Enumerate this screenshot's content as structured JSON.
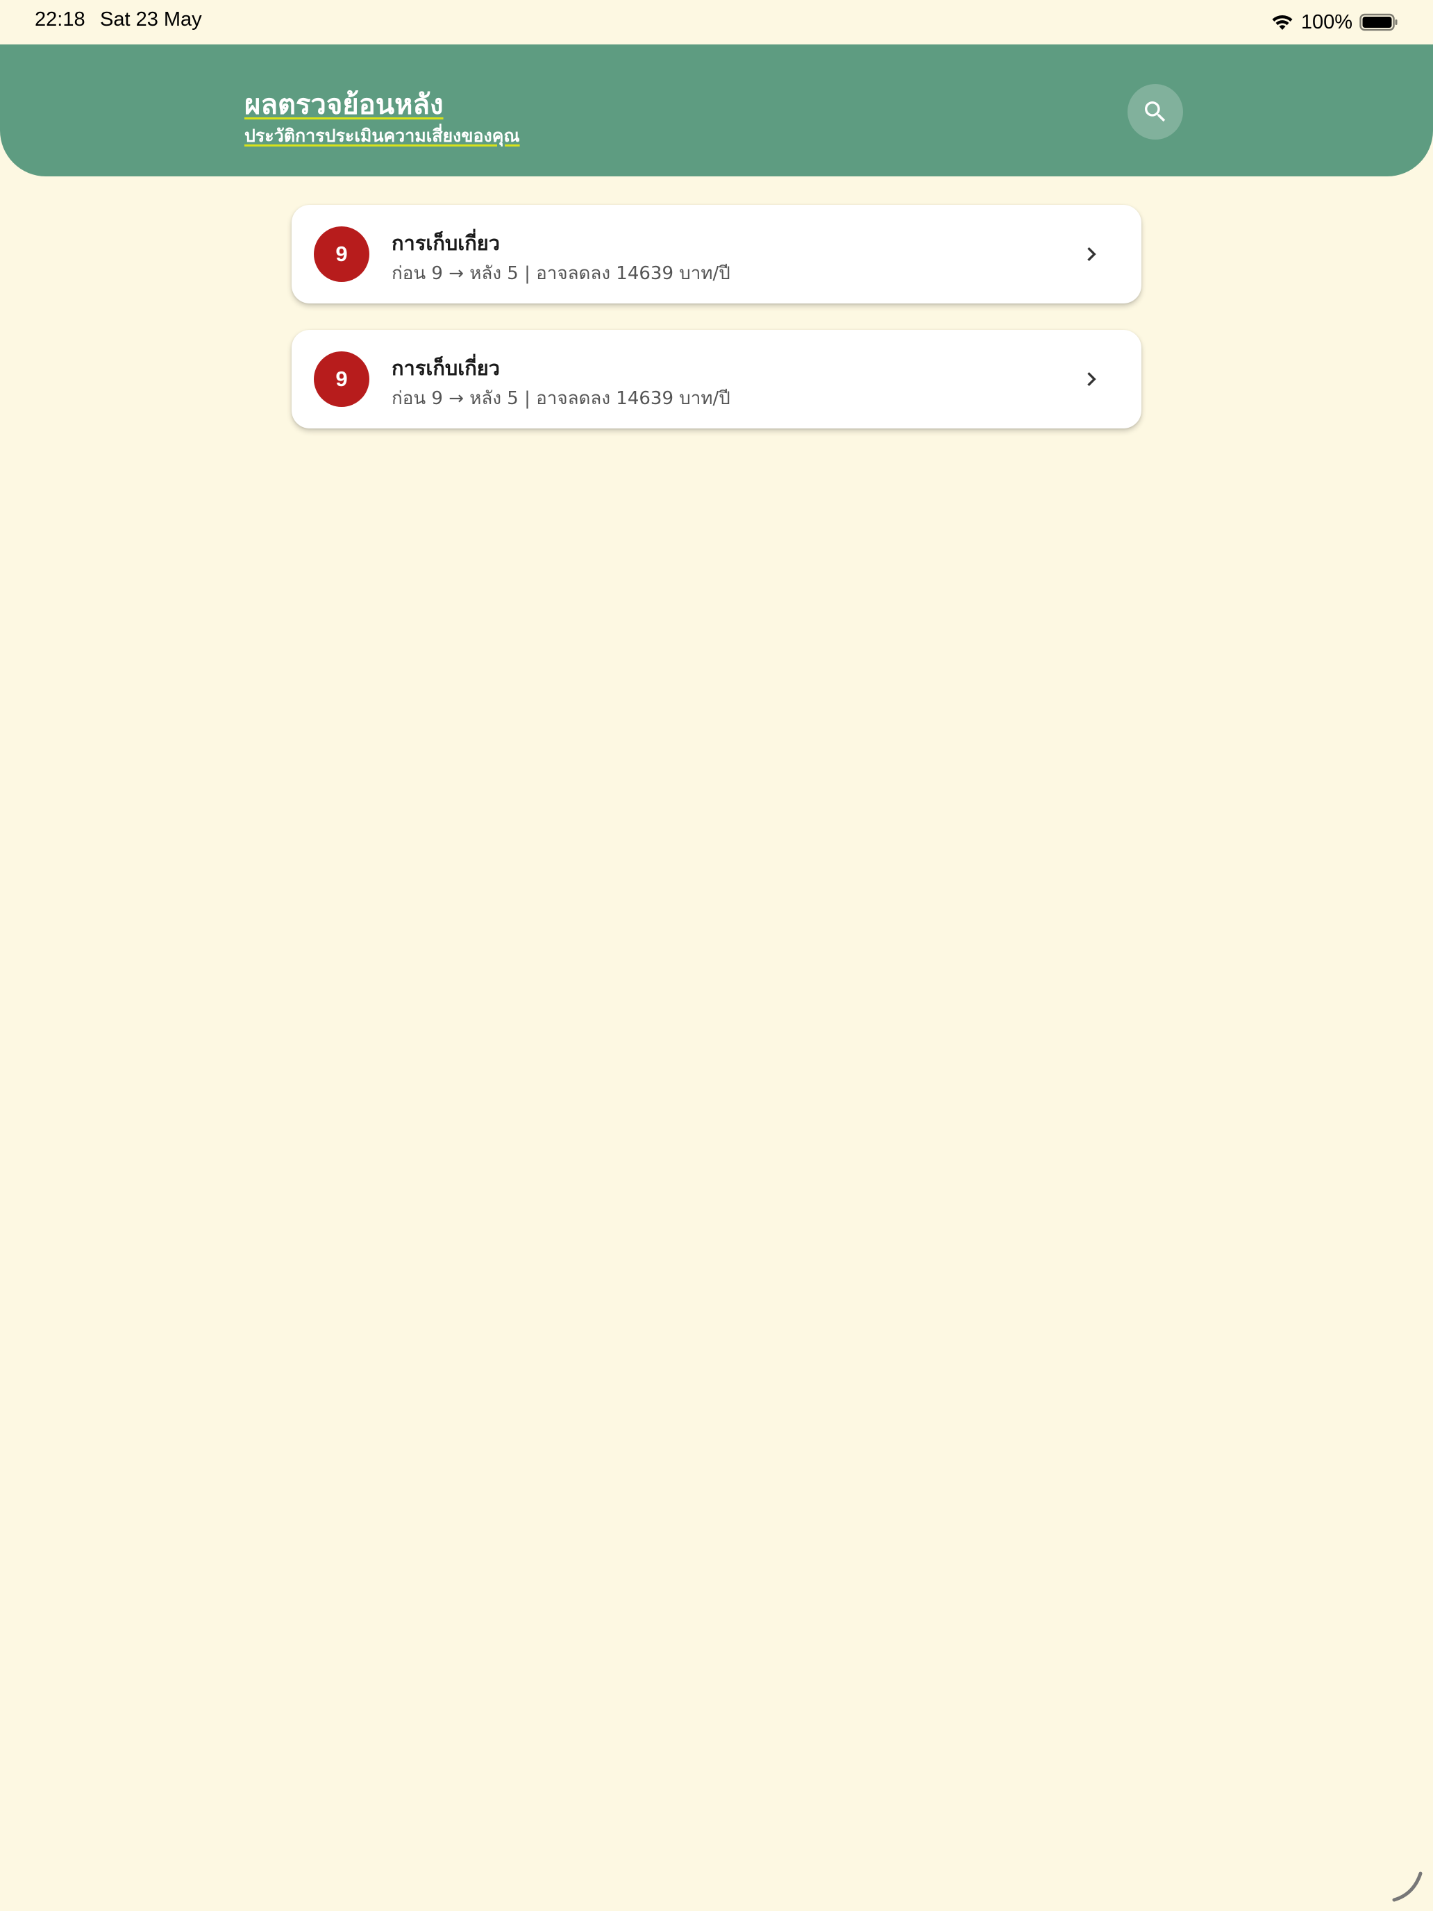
{
  "status_bar": {
    "time": "22:18",
    "date": "Sat 23 May",
    "battery": "100%",
    "wifi_icon": "wifi-icon",
    "battery_icon": "battery-full-icon"
  },
  "header": {
    "title": "ผลตรวจย้อนหลัง",
    "subtitle": "ประวัติการประเมินความเสี่ยงของคุณ",
    "search_icon": "search-icon",
    "background_color": "#5e9c81",
    "underline_color": "#d8e21a"
  },
  "history": {
    "items": [
      {
        "score": "9",
        "title": "การเก็บเกี่ยว",
        "detail": "ก่อน 9 → หลัง 5 | อาจลดลง 14639 บาท/ปี",
        "badge_color": "#b71c1c"
      },
      {
        "score": "9",
        "title": "การเก็บเกี่ยว",
        "detail": "ก่อน 9 → หลัง 5 | อาจลดลง 14639 บาท/ปี",
        "badge_color": "#b71c1c"
      }
    ]
  },
  "colors": {
    "background": "#fdf8e2",
    "card": "#ffffff"
  }
}
